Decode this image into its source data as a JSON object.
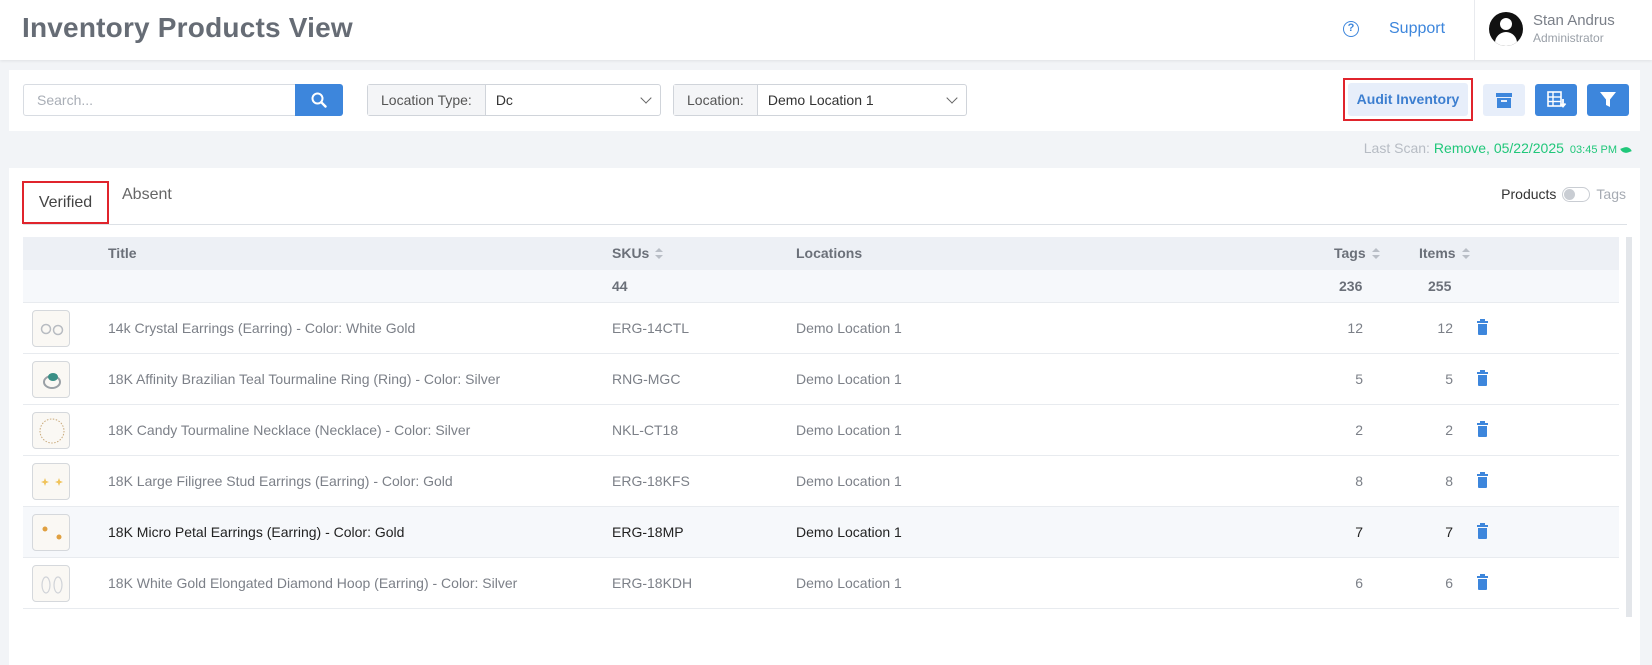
{
  "header": {
    "title": "Inventory Products View",
    "support_label": "Support",
    "user_name": "Stan Andrus",
    "user_role": "Administrator"
  },
  "toolbar": {
    "search_placeholder": "Search...",
    "location_type_label": "Location Type:",
    "location_type_value": "Dc",
    "location_label": "Location:",
    "location_value": "Demo Location 1",
    "audit_label": "Audit Inventory"
  },
  "last_scan": {
    "label": "Last Scan:",
    "value": "Remove, 05/22/2025",
    "time": "03:45 PM"
  },
  "tabs": {
    "verified": "Verified",
    "absent": "Absent"
  },
  "toggle": {
    "left": "Products",
    "right": "Tags"
  },
  "table": {
    "headers": {
      "title": "Title",
      "skus": "SKUs",
      "locations": "Locations",
      "tags": "Tags",
      "items": "Items"
    },
    "totals": {
      "skus": "44",
      "tags": "236",
      "items": "255"
    },
    "rows": [
      {
        "title": "14k Crystal Earrings (Earring) - Color: White Gold",
        "sku": "ERG-14CTL",
        "location": "Demo Location 1",
        "tags": "12",
        "items": "12",
        "thumb": "crystal-earrings"
      },
      {
        "title": "18K Affinity Brazilian Teal Tourmaline Ring (Ring) - Color: Silver",
        "sku": "RNG-MGC",
        "location": "Demo Location 1",
        "tags": "5",
        "items": "5",
        "thumb": "ring"
      },
      {
        "title": "18K Candy Tourmaline Necklace (Necklace) - Color: Silver",
        "sku": "NKL-CT18",
        "location": "Demo Location 1",
        "tags": "2",
        "items": "2",
        "thumb": "necklace"
      },
      {
        "title": "18K Large Filigree Stud Earrings (Earring) - Color: Gold",
        "sku": "ERG-18KFS",
        "location": "Demo Location 1",
        "tags": "8",
        "items": "8",
        "thumb": "stud-earrings"
      },
      {
        "title": "18K Micro Petal Earrings (Earring) - Color: Gold",
        "sku": "ERG-18MP",
        "location": "Demo Location 1",
        "tags": "7",
        "items": "7",
        "thumb": "petal-earrings"
      },
      {
        "title": "18K White Gold Elongated Diamond Hoop (Earring) - Color: Silver",
        "sku": "ERG-18KDH",
        "location": "Demo Location 1",
        "tags": "6",
        "items": "6",
        "thumb": "hoop-earrings"
      }
    ]
  },
  "colors": {
    "accent": "#3d86dc",
    "highlight_border": "#e0242c",
    "scan_green": "#20c77a"
  }
}
